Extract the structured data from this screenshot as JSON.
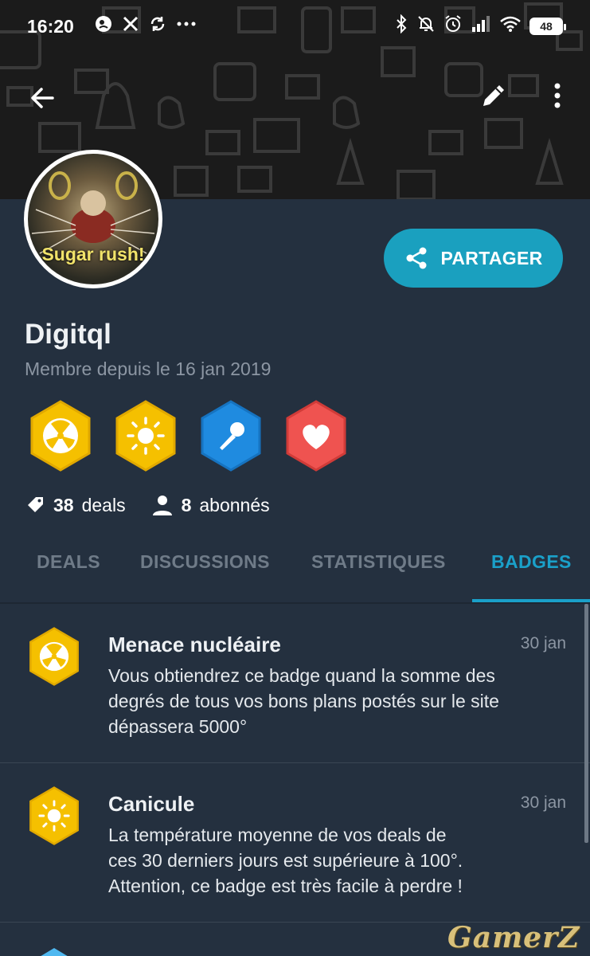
{
  "status_bar": {
    "time": "16:20",
    "battery": "48",
    "left_icons": [
      "app-icon",
      "x-icon",
      "sync-icon",
      "more-dots-icon"
    ],
    "right_icons": [
      "bluetooth-icon",
      "mute-icon",
      "alarm-icon",
      "signal-icon",
      "wifi-icon",
      "battery-icon"
    ]
  },
  "toolbar": {
    "back_icon": "arrow-left-icon",
    "edit_icon": "pencil-icon",
    "more_icon": "more-vertical-icon"
  },
  "profile": {
    "avatar_caption": "Sugar rush!",
    "share_label": "PARTAGER",
    "username": "Digitql",
    "member_since": "Membre depuis le 16 jan 2019",
    "badges": [
      {
        "icon": "nuclear-icon",
        "color": "#f5c000"
      },
      {
        "icon": "sun-icon",
        "color": "#f5c000"
      },
      {
        "icon": "microphone-icon",
        "color": "#1f8be0"
      },
      {
        "icon": "heart-icon",
        "color": "#ef5350"
      }
    ],
    "deals_count": "38",
    "deals_label": "deals",
    "followers_count": "8",
    "followers_label": "abonnés"
  },
  "tabs": [
    {
      "label": "DEALS",
      "active": false
    },
    {
      "label": "DISCUSSIONS",
      "active": false
    },
    {
      "label": "STATISTIQUES",
      "active": false
    },
    {
      "label": "BADGES",
      "active": true
    }
  ],
  "badges_list": [
    {
      "icon": "nuclear-icon",
      "title": "Menace nucléaire",
      "date": "30 jan",
      "lines": [
        "Vous obtiendrez ce badge quand la somme des",
        "degrés de tous vos bons plans postés sur le site",
        "dépassera 5000°"
      ]
    },
    {
      "icon": "sun-icon",
      "title": "Canicule",
      "date": "30 jan",
      "lines": [
        "La température moyenne de vos deals de",
        "ces 30 derniers jours est supérieure à 100°.",
        "Attention, ce badge est très facile à perdre !"
      ]
    }
  ],
  "watermark": "GamerZ",
  "colors": {
    "accent": "#1aa0c9",
    "share_button": "#1aa0bf",
    "background": "#24303f",
    "badge_gold": "#f5c000",
    "badge_blue": "#1f8be0",
    "badge_red": "#ef5350"
  }
}
